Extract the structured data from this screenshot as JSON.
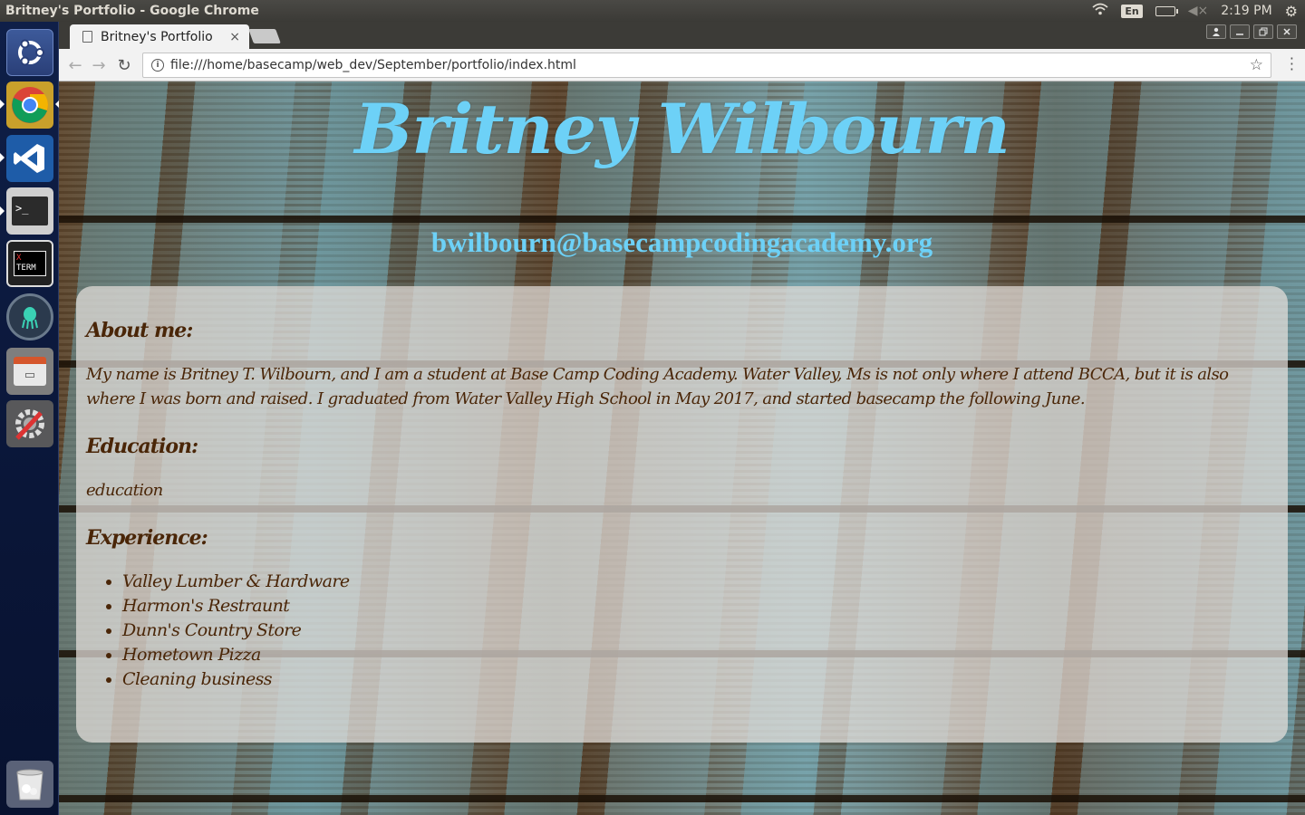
{
  "os": {
    "window_title": "Britney's Portfolio - Google Chrome",
    "lang_indicator": "En",
    "clock": "2:19 PM"
  },
  "launcher": {
    "apps": [
      "ubuntu-dash-icon",
      "chrome-icon",
      "vscode-icon",
      "terminal-icon",
      "xterm-icon",
      "gitkraken-icon",
      "files-icon",
      "settings-tools-icon",
      "trash-icon"
    ],
    "xterm_label_top": "X",
    "xterm_label": "TERM"
  },
  "browser": {
    "tab_title": "Britney's Portfolio",
    "tab_close": "×",
    "url": "file:///home/basecamp/web_dev/September/portfolio/index.html",
    "back": "←",
    "forward": "→",
    "reload": "↻",
    "star": "☆"
  },
  "page": {
    "name": "Britney Wilbourn",
    "email": "bwilbourn@basecampcodingacademy.org",
    "about_heading": "About me:",
    "about_text": "My name is Britney T. Wilbourn, and I am a student at Base Camp Coding Academy. Water Valley, Ms is not only where I attend BCCA, but it is also where I was born and raised. I graduated from Water Valley High School in May 2017, and started basecamp the following June.",
    "education_heading": "Education:",
    "education_text": "education",
    "experience_heading": "Experience:",
    "experience_items": [
      "Valley Lumber & Hardware",
      "Harmon's Restraunt",
      "Dunn's Country Store",
      "Hometown Pizza",
      "Cleaning business"
    ]
  },
  "colors": {
    "heading_blue": "#6dd1f7",
    "text_brown": "#4a2608"
  }
}
